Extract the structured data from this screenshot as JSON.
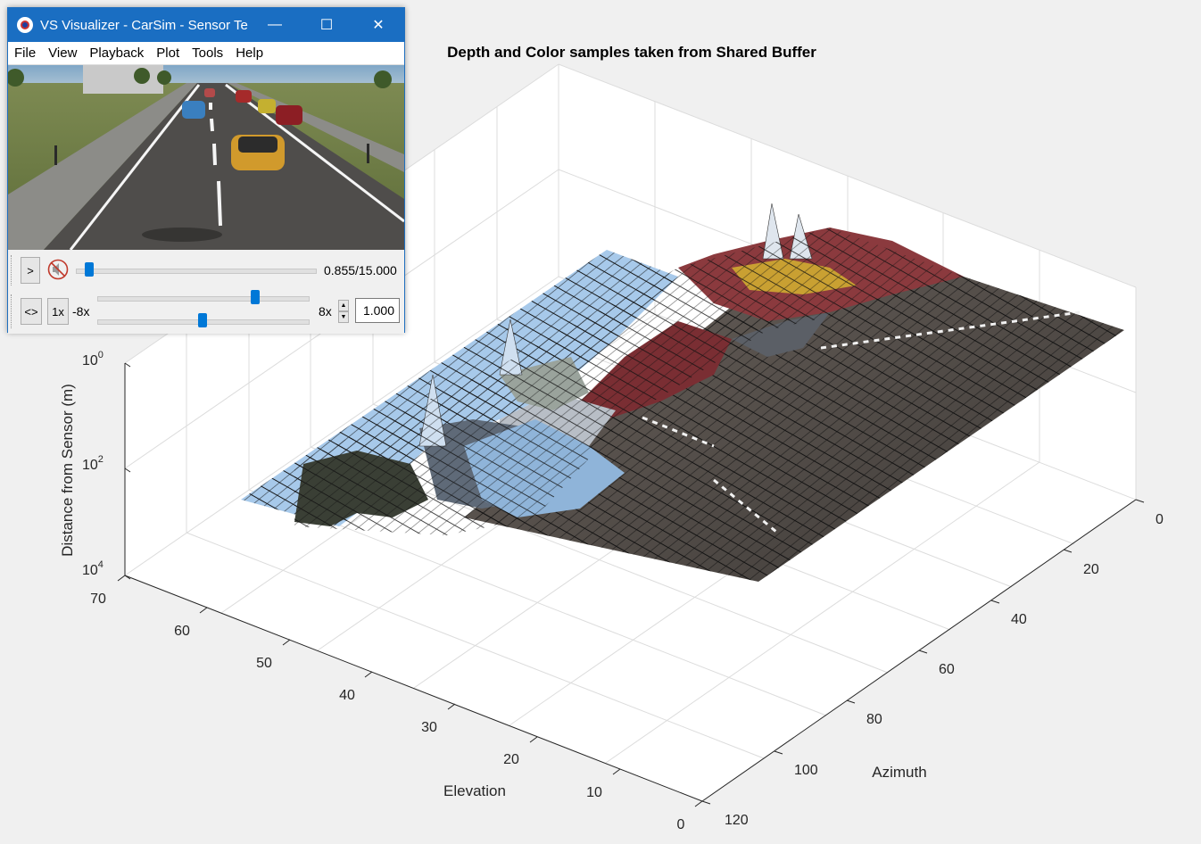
{
  "figure": {
    "title": "Depth and Color samples taken from Shared Buffer",
    "axes": {
      "z_label": "Distance from Sensor (m)",
      "z_ticks": [
        {
          "base": "10",
          "exp": "0"
        },
        {
          "base": "10",
          "exp": "2"
        },
        {
          "base": "10",
          "exp": "4"
        }
      ],
      "elevation_label": "Elevation",
      "elevation_ticks": [
        "70",
        "60",
        "50",
        "40",
        "30",
        "20",
        "10",
        "0"
      ],
      "azimuth_label": "Azimuth",
      "azimuth_ticks": [
        "0",
        "20",
        "40",
        "60",
        "80",
        "100",
        "120"
      ]
    }
  },
  "chart_data": {
    "type": "surface",
    "title": "Depth and Color samples taken from Shared Buffer",
    "xlabel": "Azimuth",
    "ylabel": "Elevation",
    "zlabel": "Distance from Sensor (m)",
    "xlim": [
      0,
      120
    ],
    "ylim": [
      0,
      70
    ],
    "zlim": [
      1,
      10000
    ],
    "z_scale": "log",
    "z_direction": "reversed",
    "grid": true
  },
  "visualizer": {
    "title": "VS Visualizer - CarSim - Sensor Te...",
    "window_buttons": {
      "minimize": "—",
      "maximize": "☐",
      "close": "✕"
    },
    "menu": [
      "File",
      "View",
      "Playback",
      "Plot",
      "Tools",
      "Help"
    ],
    "controls": {
      "play_label": ">",
      "loop_label": "<>",
      "speed_reset_label": "1x",
      "speed_min_label": "-8x",
      "speed_max_label": "8x",
      "time_readout": "0.855/15.000",
      "speed_value": "1.000",
      "time_progress": 0.057,
      "speed_slider_position": 0.75,
      "second_slider_position": 0.5
    }
  },
  "colors": {
    "titlebar": "#1a6ec2",
    "slider_thumb": "#0078d7",
    "road": "#5b5854",
    "sky_surface": "#9ec3e6"
  }
}
